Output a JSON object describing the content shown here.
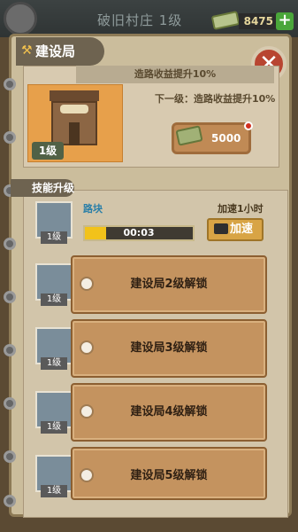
{
  "topbar": {
    "village": "破旧村庄  1级",
    "money": "8475",
    "plus": "+"
  },
  "title": {
    "text": "建设局",
    "close": "✕"
  },
  "building": {
    "bonus": "造路收益提升10%",
    "next_level": "下一级：造路收益提升10%",
    "current_level": "1级",
    "upgrade_cost": "5000"
  },
  "skills": {
    "section_title": "技能升级",
    "active": {
      "name": "路块",
      "speed_label": "加速1小时",
      "timer": "00:03",
      "level": "1级",
      "speed_button": "加速",
      "progress": 0.2
    },
    "locked": [
      {
        "label": "建设局2级解锁",
        "level": "1级"
      },
      {
        "label": "建设局3级解锁",
        "level": "1级"
      },
      {
        "label": "建设局4级解锁",
        "level": "1级"
      },
      {
        "label": "建设局5级解锁",
        "level": "1级"
      }
    ]
  }
}
